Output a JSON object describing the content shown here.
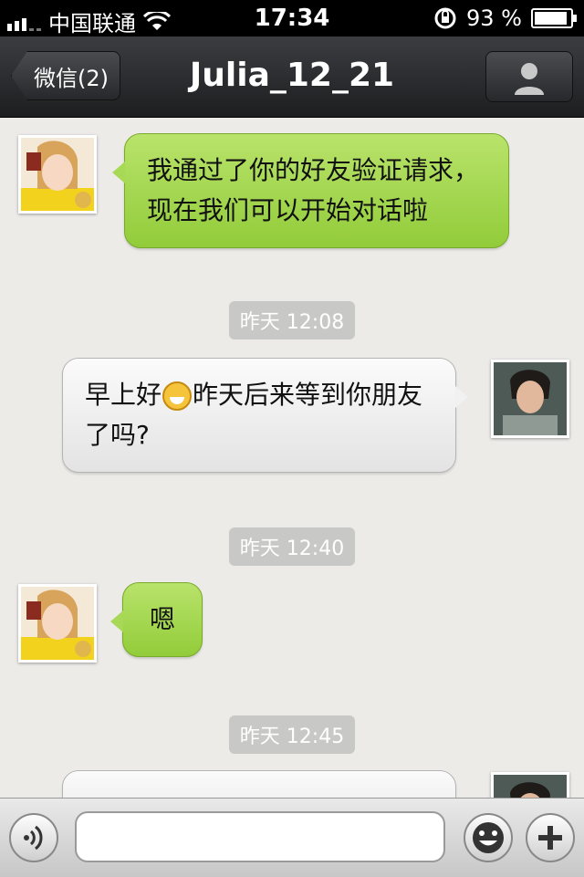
{
  "status_bar": {
    "carrier": "中国联通",
    "time": "17:34",
    "battery": "93 %"
  },
  "nav": {
    "back_label": "微信(2)",
    "title": "Julia_12_21"
  },
  "messages": [
    {
      "from": "contact",
      "text": "我通过了你的好友验证请求，现在我们可以开始对话啦"
    },
    {
      "timestamp": "昨天 12:08"
    },
    {
      "from": "me",
      "text_before": "早上好",
      "emoji": "grin-emoji",
      "text_after": "昨天后来等到你朋友了吗?"
    },
    {
      "timestamp": "昨天 12:40"
    },
    {
      "from": "contact",
      "text": "嗯"
    },
    {
      "timestamp": "昨天 12:45"
    }
  ],
  "input": {
    "placeholder": ""
  },
  "colors": {
    "green_bubble": "#a7d956",
    "gray_bubble": "#f1f1f1",
    "nav_bar": "#2b2c2f"
  }
}
